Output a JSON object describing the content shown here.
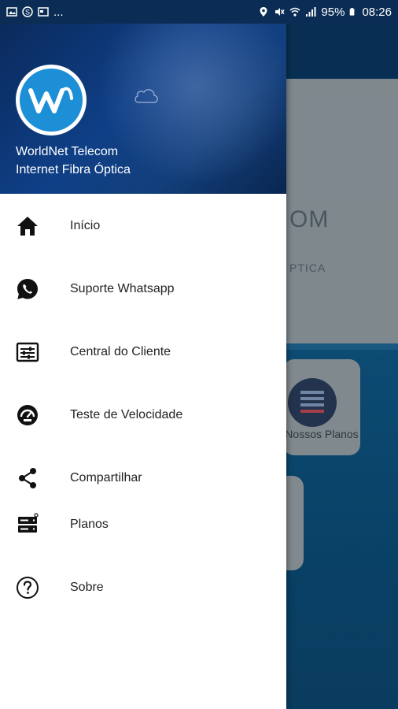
{
  "status_bar": {
    "battery": "95%",
    "time": "08:26",
    "left_icons": [
      "image-icon",
      "skype-icon",
      "calendar-icon"
    ],
    "more": "..."
  },
  "background_app": {
    "brand_line1": "OM",
    "brand_line2": "PTICA",
    "card_label": "Nossos Planos"
  },
  "drawer": {
    "header": {
      "title": "WorldNet Telecom",
      "subtitle": "Internet Fibra Óptica",
      "logo_colors": {
        "ring": "#ffffff",
        "fill": "#1c8fd6"
      }
    },
    "items": [
      {
        "label": "Início",
        "icon": "home-icon"
      },
      {
        "label": "Suporte Whatsapp",
        "icon": "whatsapp-icon"
      },
      {
        "label": "Central do Cliente",
        "icon": "sliders-icon"
      },
      {
        "label": "Teste de Velocidade",
        "icon": "speedtest-icon"
      },
      {
        "label": "Compartilhar",
        "icon": "share-icon"
      },
      {
        "label": "Planos",
        "icon": "server-icon"
      },
      {
        "label": "Sobre",
        "icon": "help-icon"
      }
    ]
  },
  "colors": {
    "status_bar": "#0b2d55",
    "accent": "#1c8fd6",
    "text": "#222222"
  }
}
